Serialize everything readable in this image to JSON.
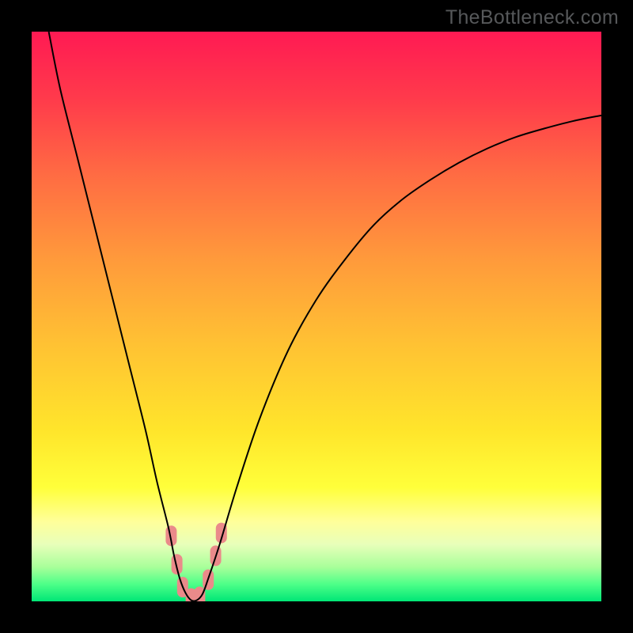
{
  "watermark": "TheBottleneck.com",
  "chart_data": {
    "type": "line",
    "title": "",
    "xlabel": "",
    "ylabel": "",
    "xlim": [
      0,
      100
    ],
    "ylim": [
      0,
      100
    ],
    "grid": false,
    "legend": false,
    "background": {
      "type": "vertical-gradient",
      "stops": [
        {
          "pos": 0.0,
          "color": "#ff1a53"
        },
        {
          "pos": 0.12,
          "color": "#ff3b4b"
        },
        {
          "pos": 0.25,
          "color": "#ff6b43"
        },
        {
          "pos": 0.4,
          "color": "#ff9a3b"
        },
        {
          "pos": 0.55,
          "color": "#ffc233"
        },
        {
          "pos": 0.7,
          "color": "#ffe52b"
        },
        {
          "pos": 0.8,
          "color": "#ffff3a"
        },
        {
          "pos": 0.86,
          "color": "#ffff9a"
        },
        {
          "pos": 0.9,
          "color": "#e8ffba"
        },
        {
          "pos": 0.94,
          "color": "#a8ff9a"
        },
        {
          "pos": 0.97,
          "color": "#4dff88"
        },
        {
          "pos": 1.0,
          "color": "#00e676"
        }
      ]
    },
    "series": [
      {
        "name": "bottleneck-curve",
        "color": "#000000",
        "stroke_width": 2,
        "x": [
          3,
          5,
          8,
          11,
          14,
          17,
          20,
          22,
          24,
          25,
          26,
          27,
          28,
          29,
          30,
          31,
          33,
          36,
          40,
          45,
          50,
          55,
          60,
          65,
          70,
          75,
          80,
          85,
          90,
          95,
          100
        ],
        "y": [
          100,
          90,
          78,
          66,
          54,
          42,
          30,
          21,
          13,
          8,
          4,
          1.5,
          0.2,
          0.2,
          1.3,
          4,
          10,
          20,
          32,
          44,
          53,
          60,
          66,
          70.5,
          74,
          77,
          79.5,
          81.5,
          83,
          84.3,
          85.3
        ]
      }
    ],
    "markers": [
      {
        "name": "highlight-segment",
        "color": "#ea8a8a",
        "x": 24.5,
        "y": 11.5,
        "size": 9
      },
      {
        "name": "highlight-segment",
        "color": "#ea8a8a",
        "x": 25.5,
        "y": 6.5,
        "size": 9
      },
      {
        "name": "highlight-segment",
        "color": "#ea8a8a",
        "x": 26.5,
        "y": 2.5,
        "size": 9
      },
      {
        "name": "highlight-segment",
        "color": "#ea8a8a",
        "x": 28.0,
        "y": 0.5,
        "size": 9
      },
      {
        "name": "highlight-segment",
        "color": "#ea8a8a",
        "x": 29.5,
        "y": 0.8,
        "size": 9
      },
      {
        "name": "highlight-segment",
        "color": "#ea8a8a",
        "x": 31.0,
        "y": 3.8,
        "size": 9
      },
      {
        "name": "highlight-segment",
        "color": "#ea8a8a",
        "x": 32.3,
        "y": 8.0,
        "size": 9
      },
      {
        "name": "highlight-segment",
        "color": "#ea8a8a",
        "x": 33.3,
        "y": 12.0,
        "size": 9
      }
    ]
  }
}
